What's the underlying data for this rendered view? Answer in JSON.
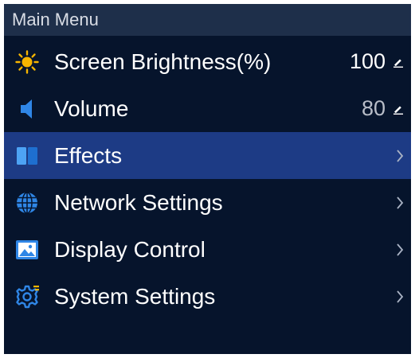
{
  "header": {
    "title": "Main Menu"
  },
  "menu": {
    "items": [
      {
        "label": "Screen Brightness(%)",
        "value": "100",
        "icon": "sun-icon",
        "control": "edit"
      },
      {
        "label": "Volume",
        "value": "80",
        "icon": "speaker-icon",
        "control": "edit"
      },
      {
        "label": "Effects",
        "icon": "effects-icon",
        "control": "submenu",
        "selected": true
      },
      {
        "label": "Network Settings",
        "icon": "globe-icon",
        "control": "submenu"
      },
      {
        "label": "Display Control",
        "icon": "image-icon",
        "control": "submenu"
      },
      {
        "label": "System Settings",
        "icon": "gear-icon",
        "control": "submenu"
      }
    ]
  },
  "colors": {
    "background": "#06142c",
    "header": "#1e2f4a",
    "selected_row": "#1d3b85",
    "accent_icon": "#2f86e6",
    "sun": "#f7b500"
  }
}
